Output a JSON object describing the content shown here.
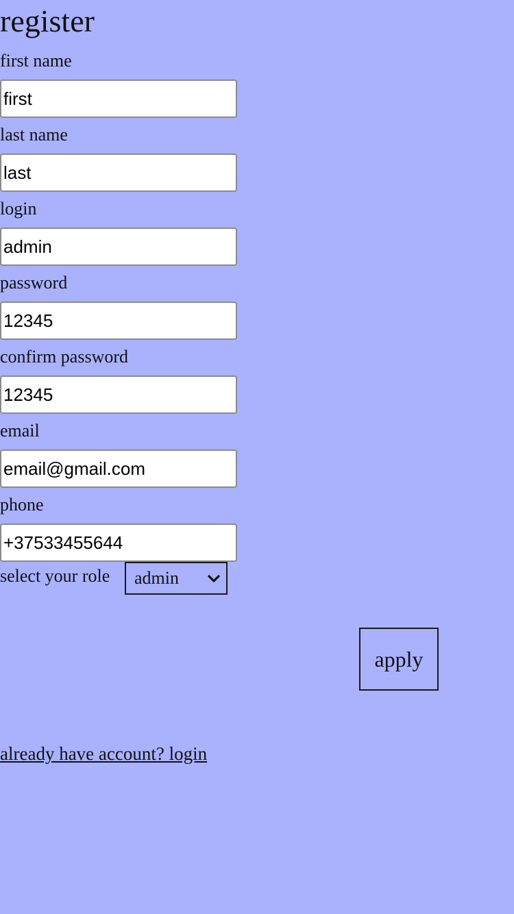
{
  "page": {
    "title": "register"
  },
  "form": {
    "first_name": {
      "label": "first name",
      "value": "first"
    },
    "last_name": {
      "label": "last name",
      "value": "last"
    },
    "login": {
      "label": "login",
      "value": "admin"
    },
    "password": {
      "label": "password",
      "value": "12345"
    },
    "confirm_password": {
      "label": "confirm password",
      "value": "12345"
    },
    "email": {
      "label": "email",
      "value": "email@gmail.com"
    },
    "phone": {
      "label": "phone",
      "value": "+37533455644"
    },
    "role": {
      "label": "select your role",
      "selected": "admin",
      "icon": "chevron-down-icon"
    },
    "apply_label": "apply"
  },
  "footer": {
    "login_link": "already have account? login"
  },
  "colors": {
    "background": "#aab2fe",
    "field_background": "#ffffff",
    "text": "#111111"
  }
}
